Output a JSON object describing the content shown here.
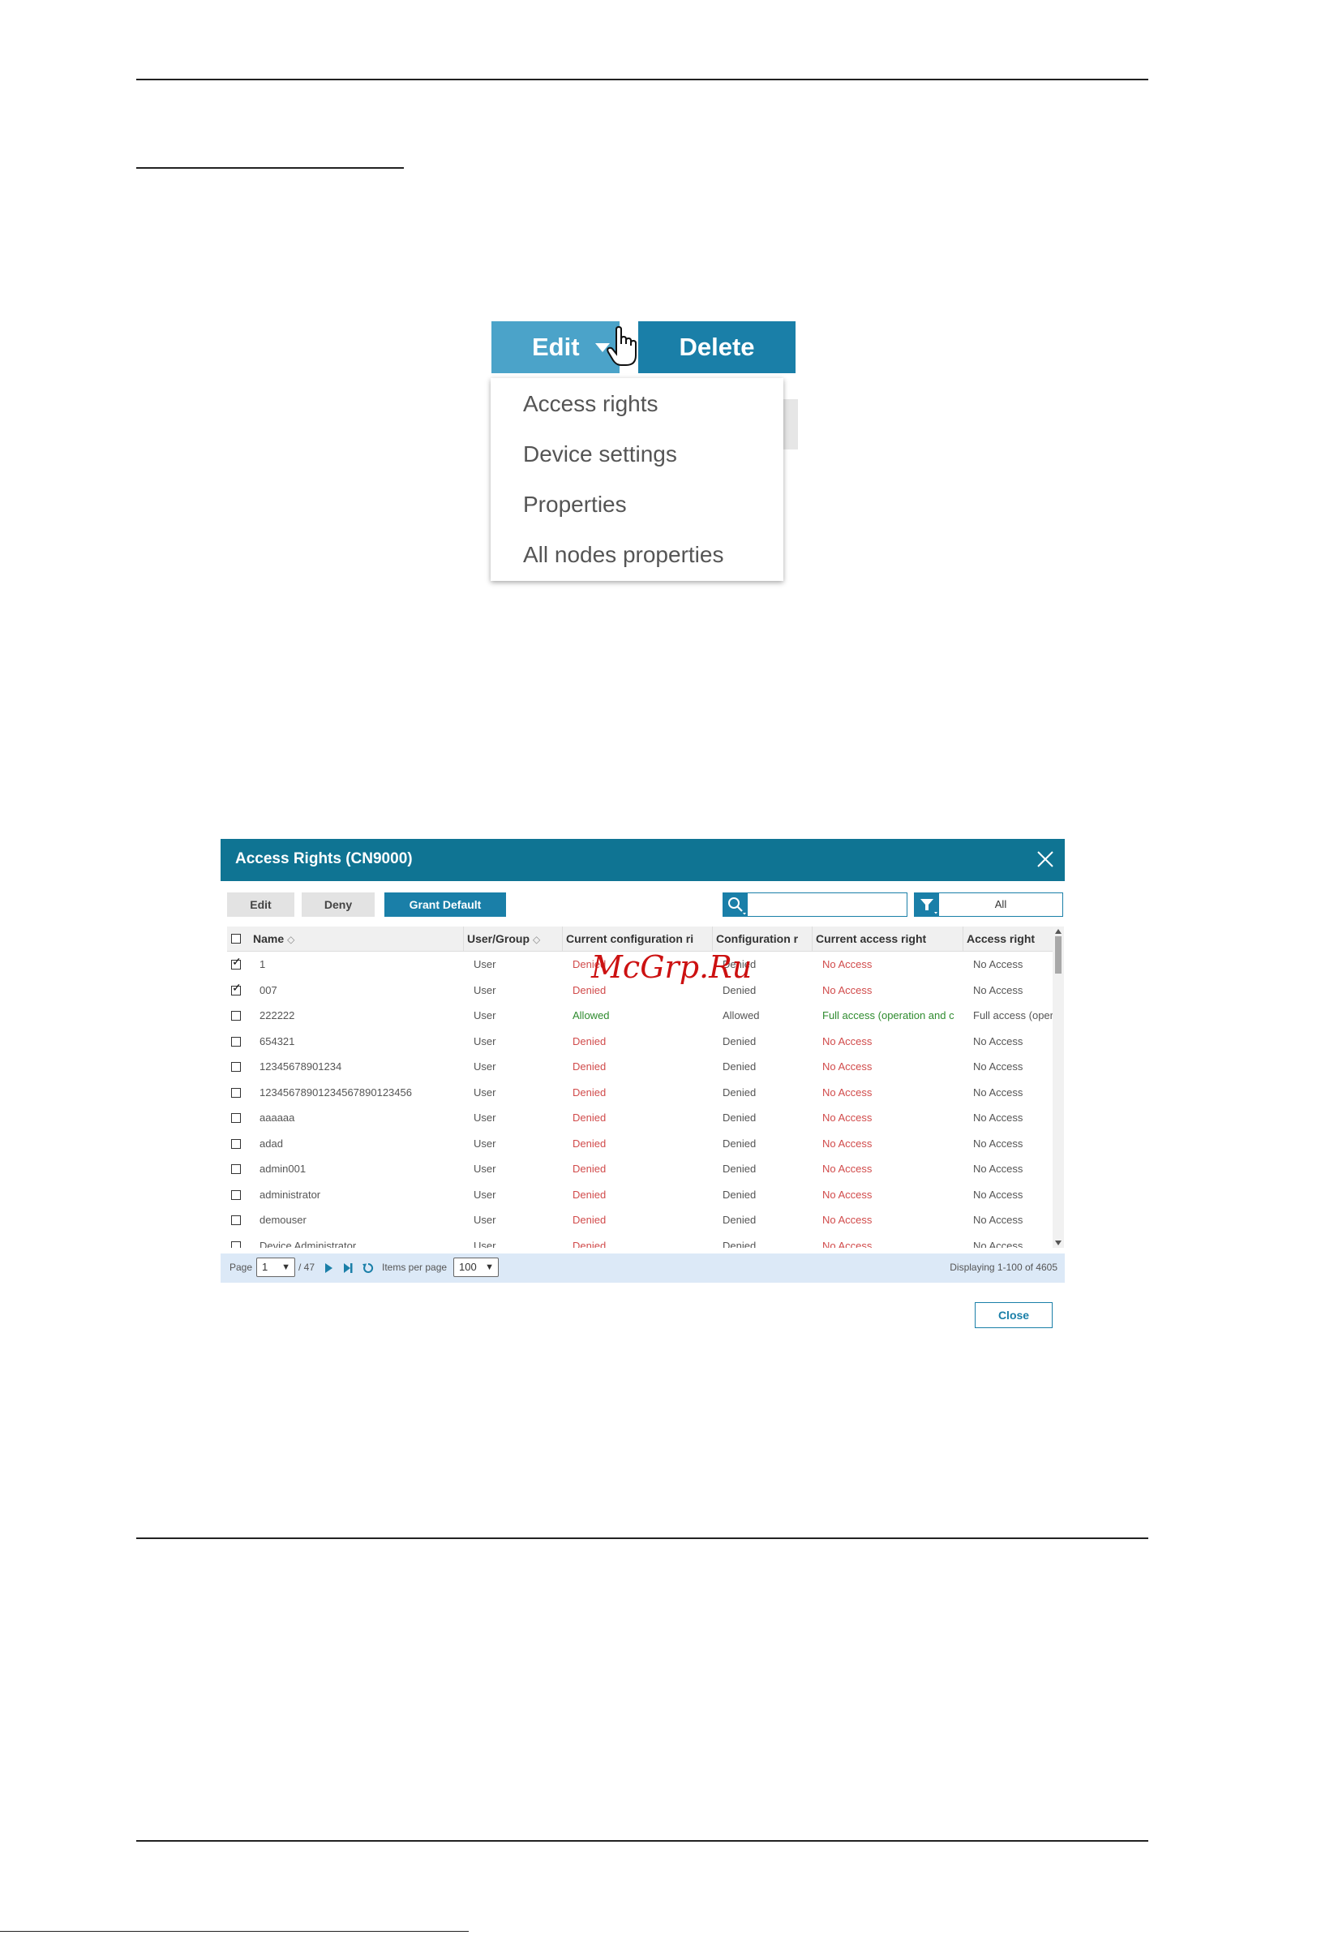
{
  "edit_menu_figure": {
    "edit_label": "Edit",
    "delete_label": "Delete",
    "menu_items": [
      "Access rights",
      "Device settings",
      "Properties",
      "All nodes properties"
    ]
  },
  "dialog": {
    "title": "Access Rights (CN9000)",
    "toolbar": {
      "edit": "Edit",
      "deny": "Deny",
      "grant_default": "Grant Default"
    },
    "search_value": "",
    "filter_value": "All",
    "columns": [
      "Name",
      "User/Group",
      "Current configuration ri",
      "Configuration r",
      "Current access right",
      "Access right"
    ],
    "rows": [
      {
        "checked": true,
        "name": "1",
        "type": "User",
        "cur_conf": "Denied",
        "conf": "Denied",
        "cur_access": "No Access",
        "access": "No Access"
      },
      {
        "checked": true,
        "name": "007",
        "type": "User",
        "cur_conf": "Denied",
        "conf": "Denied",
        "cur_access": "No Access",
        "access": "No Access"
      },
      {
        "checked": false,
        "name": "222222",
        "type": "User",
        "cur_conf": "Allowed",
        "conf": "Allowed",
        "cur_access": "Full access (operation and c",
        "access": "Full access (opera"
      },
      {
        "checked": false,
        "name": "654321",
        "type": "User",
        "cur_conf": "Denied",
        "conf": "Denied",
        "cur_access": "No Access",
        "access": "No Access"
      },
      {
        "checked": false,
        "name": "12345678901234",
        "type": "User",
        "cur_conf": "Denied",
        "conf": "Denied",
        "cur_access": "No Access",
        "access": "No Access"
      },
      {
        "checked": false,
        "name": "12345678901234567890123456",
        "type": "User",
        "cur_conf": "Denied",
        "conf": "Denied",
        "cur_access": "No Access",
        "access": "No Access"
      },
      {
        "checked": false,
        "name": "aaaaaa",
        "type": "User",
        "cur_conf": "Denied",
        "conf": "Denied",
        "cur_access": "No Access",
        "access": "No Access"
      },
      {
        "checked": false,
        "name": "adad",
        "type": "User",
        "cur_conf": "Denied",
        "conf": "Denied",
        "cur_access": "No Access",
        "access": "No Access"
      },
      {
        "checked": false,
        "name": "admin001",
        "type": "User",
        "cur_conf": "Denied",
        "conf": "Denied",
        "cur_access": "No Access",
        "access": "No Access"
      },
      {
        "checked": false,
        "name": "administrator",
        "type": "User",
        "cur_conf": "Denied",
        "conf": "Denied",
        "cur_access": "No Access",
        "access": "No Access"
      },
      {
        "checked": false,
        "name": "demouser",
        "type": "User",
        "cur_conf": "Denied",
        "conf": "Denied",
        "cur_access": "No Access",
        "access": "No Access"
      },
      {
        "checked": false,
        "name": "Device Administrator",
        "type": "User",
        "cur_conf": "Denied",
        "conf": "Denied",
        "cur_access": "No Access",
        "access": "No Access"
      }
    ],
    "pager": {
      "page_label": "Page",
      "page_value": "1",
      "total_pages": "/ 47",
      "items_per_page_label": "Items per page",
      "items_per_page": "100",
      "displaying": "Displaying 1-100 of 4605"
    },
    "close_label": "Close"
  },
  "watermark": "McGrp.Ru",
  "colors": {
    "brand": "#0f7493",
    "button": "#1a7fa8",
    "denied": "#d14b4b",
    "allowed": "#2e8b2e",
    "footer_bg": "#dce9f7"
  },
  "icons": [
    "pointer-hand-icon",
    "close-icon",
    "search-icon",
    "filter-icon",
    "next-page-icon",
    "last-page-icon",
    "refresh-icon",
    "sort-icon"
  ]
}
